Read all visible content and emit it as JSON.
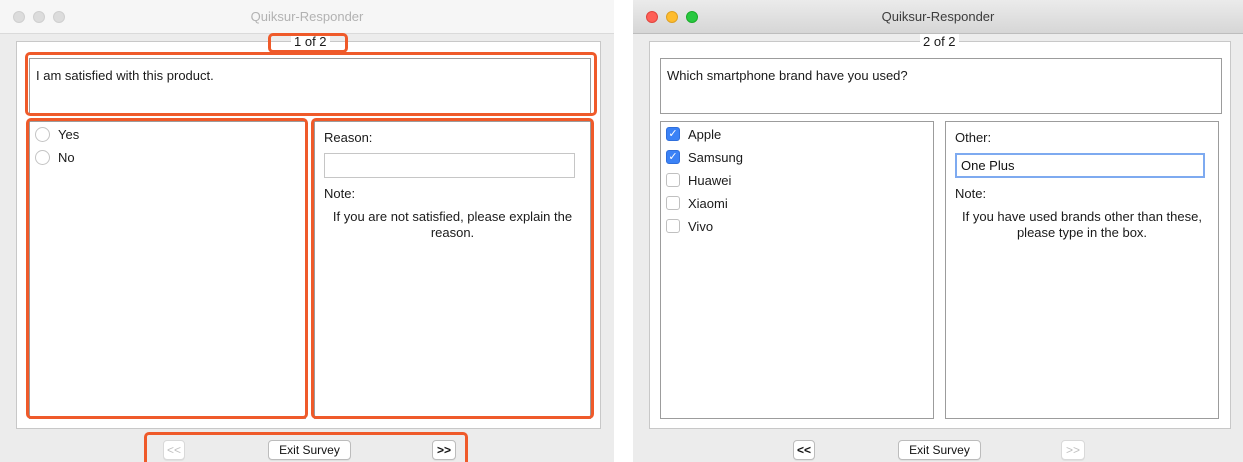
{
  "highlight_color": "#ef5a2a",
  "windows": [
    {
      "title": "Quiksur-Responder",
      "page_indicator": "1 of 2",
      "question": "I am satisfied with this product.",
      "input_type": "radio",
      "options": [
        {
          "label": "Yes",
          "selected": false
        },
        {
          "label": "No",
          "selected": false
        }
      ],
      "extra_label": "Reason:",
      "extra_value": "",
      "note_label": "Note:",
      "note_text": "If you are not satisfied, please explain the reason.",
      "buttons": {
        "prev": "<<",
        "exit": "Exit Survey",
        "next": ">>"
      }
    },
    {
      "title": "Quiksur-Responder",
      "page_indicator": "2 of 2",
      "question": "Which smartphone brand have you used?",
      "input_type": "checkbox",
      "options": [
        {
          "label": "Apple",
          "selected": true
        },
        {
          "label": "Samsung",
          "selected": true
        },
        {
          "label": "Huawei",
          "selected": false
        },
        {
          "label": "Xiaomi",
          "selected": false
        },
        {
          "label": "Vivo",
          "selected": false
        }
      ],
      "extra_label": "Other:",
      "extra_value": "One Plus",
      "note_label": "Note:",
      "note_text": "If you have used brands other than these, please type in the box.",
      "buttons": {
        "prev": "<<",
        "exit": "Exit Survey",
        "next": ">>"
      }
    }
  ]
}
